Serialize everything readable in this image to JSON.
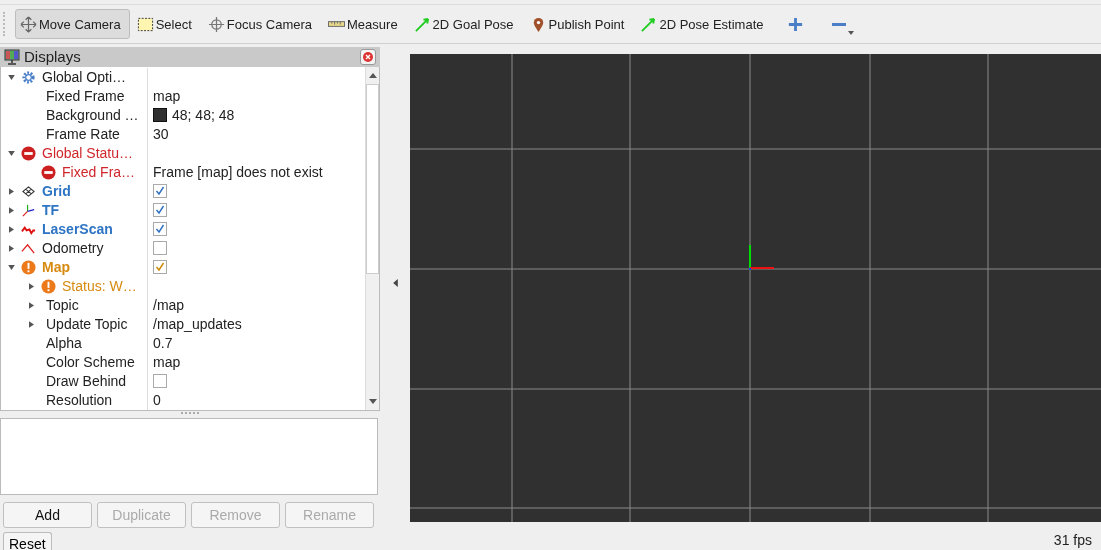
{
  "toolbar": {
    "tools": [
      {
        "label": "Move Camera",
        "kind": "move",
        "selected": true
      },
      {
        "label": "Select",
        "kind": "select",
        "selected": false
      },
      {
        "label": "Focus Camera",
        "kind": "focus",
        "selected": false
      },
      {
        "label": "Measure",
        "kind": "measure",
        "selected": false
      },
      {
        "label": "2D Goal Pose",
        "kind": "pose",
        "selected": false
      },
      {
        "label": "Publish Point",
        "kind": "point",
        "selected": false
      },
      {
        "label": "2D Pose Estimate",
        "kind": "pose",
        "selected": false
      }
    ]
  },
  "displays_panel": {
    "title": "Displays",
    "tree": [
      {
        "label": "Global Opti…",
        "kind": "options",
        "expanded": true,
        "children": [
          {
            "label": "Fixed Frame",
            "kind": "property",
            "value": "map"
          },
          {
            "label": "Background …",
            "kind": "property",
            "value": "48; 48; 48",
            "color": "#303030"
          },
          {
            "label": "Frame Rate",
            "kind": "property",
            "value": "30"
          }
        ]
      },
      {
        "label": "Global Statu…",
        "kind": "error",
        "expanded": true,
        "children": [
          {
            "label": "Fixed Fra…",
            "kind": "error",
            "value": "Frame [map] does not exist"
          }
        ]
      },
      {
        "label": "Grid",
        "kind": "grid",
        "expanded": false,
        "checked": true
      },
      {
        "label": "TF",
        "kind": "tf",
        "expanded": false,
        "checked": true
      },
      {
        "label": "LaserScan",
        "kind": "laserscan",
        "expanded": false,
        "checked": true
      },
      {
        "label": "Odometry",
        "kind": "odometry",
        "expanded": false,
        "checked": false
      },
      {
        "label": "Map",
        "kind": "warning",
        "expanded": true,
        "checked": true,
        "children": [
          {
            "label": "Status: W…",
            "kind": "warning",
            "expanded": false
          },
          {
            "label": "Topic",
            "kind": "property",
            "expanded": false,
            "value": "/map"
          },
          {
            "label": "Update Topic",
            "kind": "property",
            "expanded": false,
            "value": "/map_updates"
          },
          {
            "label": "Alpha",
            "kind": "property",
            "value": "0.7"
          },
          {
            "label": "Color Scheme",
            "kind": "property",
            "value": "map"
          },
          {
            "label": "Draw Behind",
            "kind": "property",
            "checked": false
          },
          {
            "label": "Resolution",
            "kind": "property",
            "value": "0"
          }
        ]
      }
    ],
    "buttons": [
      {
        "label": "Add",
        "disabled": false
      },
      {
        "label": "Duplicate",
        "disabled": true
      },
      {
        "label": "Remove",
        "disabled": true
      },
      {
        "label": "Rename",
        "disabled": true
      }
    ]
  },
  "status_bar": {
    "button": "Reset",
    "fps": "31 fps"
  }
}
